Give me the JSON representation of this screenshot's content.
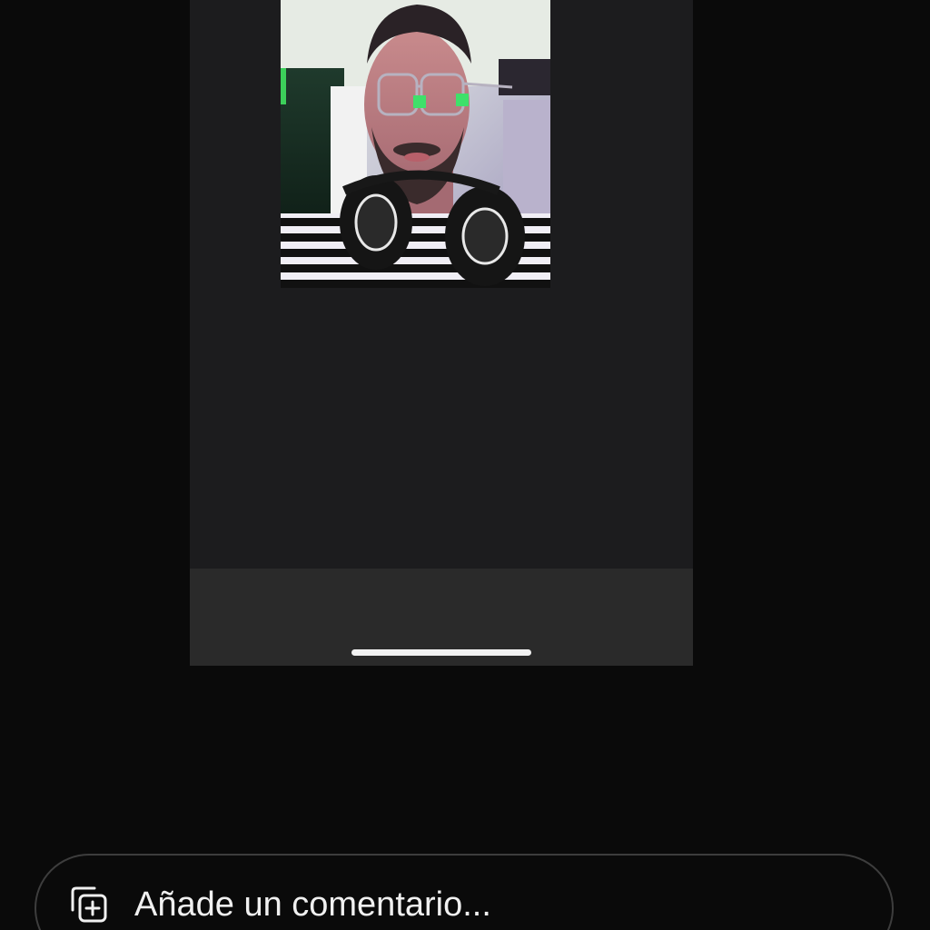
{
  "comment_bar": {
    "placeholder": "Añade un comentario...",
    "icon": "add-media-icon"
  },
  "shared_media": {
    "photo": "selfie-man-glasses-headphones",
    "home_indicator": "home-indicator-bar"
  },
  "colors": {
    "background": "#0a0a0a",
    "card": "#1c1c1e",
    "card_bottom": "#2a2a2a",
    "input_border": "#3d3d3d",
    "text": "#f0f0f0"
  }
}
